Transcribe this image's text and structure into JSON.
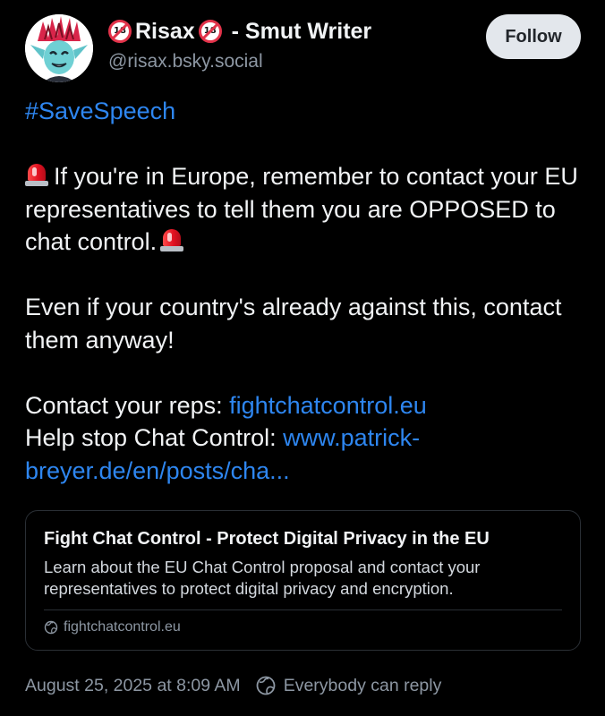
{
  "author": {
    "display_name_prefix_emoji": "🔞",
    "display_name_core": "Risax",
    "display_name_suffix_emoji": "🔞",
    "display_name_tail": " - Smut Writer",
    "handle": "@risax.bsky.social",
    "avatar_icon": "goblin-avatar"
  },
  "follow_button": {
    "label": "Follow"
  },
  "post": {
    "hashtag": "#SaveSpeech",
    "paragraph_1": "If you're in Europe, remember to contact your EU representatives to tell them you are OPPOSED to chat control.",
    "paragraph_1_emoji": "🚨",
    "paragraph_2": "Even if your country's already against this, contact them anyway!",
    "contact_label": "Contact your reps: ",
    "contact_link": "fightchatcontrol.eu",
    "help_label": "Help stop Chat Control: ",
    "help_link": "www.patrick-breyer.de/en/posts/cha..."
  },
  "link_card": {
    "title": "Fight Chat Control - Protect Digital Privacy in the EU",
    "description": "Learn about the EU Chat Control proposal and contact your representatives to protect digital privacy and encryption.",
    "domain": "fightchatcontrol.eu",
    "domain_icon": "globe-icon"
  },
  "footer": {
    "timestamp": "August 25, 2025 at 8:09 AM",
    "reply_setting": "Everybody can reply",
    "reply_icon": "globe-icon"
  },
  "colors": {
    "background": "#000000",
    "link": "#2e86f0",
    "muted": "#8d97a3",
    "follow_bg": "#e3e7ec"
  }
}
